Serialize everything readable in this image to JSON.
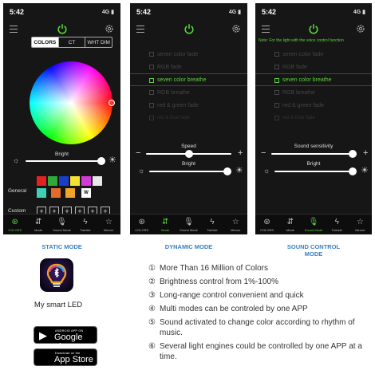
{
  "phones": {
    "static": {
      "time": "5:42",
      "signal": "4G",
      "tabs": [
        "COLORS",
        "CT",
        "WHT DIM"
      ],
      "active_tab": 0,
      "bright_label": "Bright",
      "bright_value": 0.95,
      "general_label": "General",
      "custom_label": "Custom",
      "swatches_row1": [
        "#e32222",
        "#2faa3a",
        "#1a3ec9",
        "#f4e232",
        "#d33bd9",
        "#e8e8e8"
      ],
      "swatches_row2": [
        "#3fd0b8",
        "#e46a2b",
        "#f1a52b"
      ],
      "white_swatch": "W",
      "plus_glyph": "+"
    },
    "dynamic": {
      "time": "5:42",
      "signal": "4G",
      "modes": [
        "seven color fade",
        "RGB fade",
        "seven color breathe",
        "RGB breathe",
        "red & green fade",
        "red & blue fade"
      ],
      "active_mode": 2,
      "speed_label": "Speed",
      "speed_value": 0.5,
      "bright_label": "Bright",
      "bright_value": 0.95
    },
    "sound": {
      "time": "5:42",
      "signal": "4G",
      "note": "Note: For the light with the voice control function",
      "modes": [
        "seven color fade",
        "RGB fade",
        "seven color breathe",
        "RGB breathe",
        "red & green fade",
        "red & blue fade"
      ],
      "active_mode": 2,
      "sensitivity_label": "Sound sensitivity",
      "sensitivity_value": 0.95,
      "bright_label": "Bright",
      "bright_value": 0.95
    }
  },
  "nav": {
    "items": [
      "COLORS",
      "Mode",
      "Sound Mode",
      "Twinkle",
      "Mercer"
    ],
    "icons": [
      "⊛",
      "⇵",
      "🎙",
      "ϟ",
      "☆"
    ]
  },
  "captions": {
    "static": "STATIC MODE",
    "dynamic": "DYNAMIC MODE",
    "sound_line1": "SOUND CONTROL",
    "sound_line2": "MODE"
  },
  "app": {
    "name": "My smart LED"
  },
  "stores": {
    "google_small": "ANDROID APP ON",
    "google_big": "Google play",
    "apple_small": "Download on the",
    "apple_big": "App Store"
  },
  "features": [
    {
      "n": "①",
      "text": "More Than 16 Million of Colors"
    },
    {
      "n": "②",
      "text": "Brightness control from 1%-100%"
    },
    {
      "n": "③",
      "text": "Long-range control convenient and quick"
    },
    {
      "n": "④",
      "text": "Multi modes can be controled by one APP"
    },
    {
      "n": "⑤",
      "text": "Sound activated to change color according to rhythm of music."
    },
    {
      "n": "⑥",
      "text": "Several light engines could be controlled by one APP at a time."
    }
  ],
  "colors": {
    "accent_green": "#58d33a",
    "caption_blue": "#3a7fc1",
    "phone_bg": "#161616"
  }
}
